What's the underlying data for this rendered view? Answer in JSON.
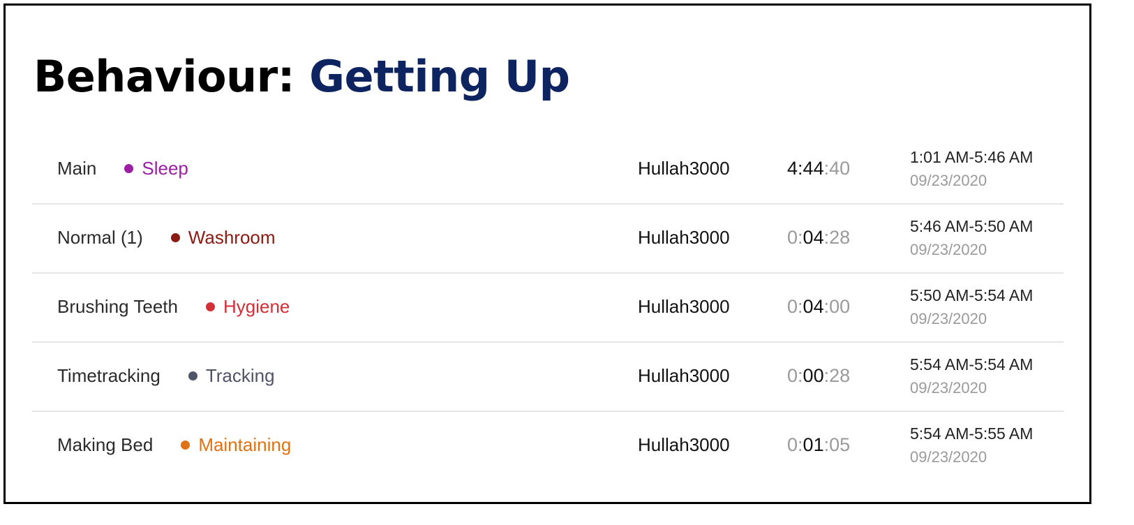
{
  "title": {
    "prefix": "Behaviour:",
    "name": "Getting Up"
  },
  "entries": [
    {
      "activity": "Main",
      "category": "Sleep",
      "category_color": "#9b1fa3",
      "user": "Hullah3000",
      "duration": {
        "h": "4",
        "m": "44",
        "s": "40"
      },
      "time_range": "1:01 AM-5:46 AM",
      "date": "09/23/2020"
    },
    {
      "activity": "Normal (1)",
      "category": "Washroom",
      "category_color": "#8b1a12",
      "user": "Hullah3000",
      "duration": {
        "h": "0",
        "m": "04",
        "s": "28"
      },
      "time_range": "5:46 AM-5:50 AM",
      "date": "09/23/2020"
    },
    {
      "activity": "Brushing Teeth",
      "category": "Hygiene",
      "category_color": "#d32f36",
      "user": "Hullah3000",
      "duration": {
        "h": "0",
        "m": "04",
        "s": "00"
      },
      "time_range": "5:50 AM-5:54 AM",
      "date": "09/23/2020"
    },
    {
      "activity": "Timetracking",
      "category": "Tracking",
      "category_color": "#505468",
      "user": "Hullah3000",
      "duration": {
        "h": "0",
        "m": "00",
        "s": "28"
      },
      "time_range": "5:54 AM-5:54 AM",
      "date": "09/23/2020"
    },
    {
      "activity": "Making Bed",
      "category": "Maintaining",
      "category_color": "#e07214",
      "user": "Hullah3000",
      "duration": {
        "h": "0",
        "m": "01",
        "s": "05"
      },
      "time_range": "5:54 AM-5:55 AM",
      "date": "09/23/2020"
    }
  ]
}
